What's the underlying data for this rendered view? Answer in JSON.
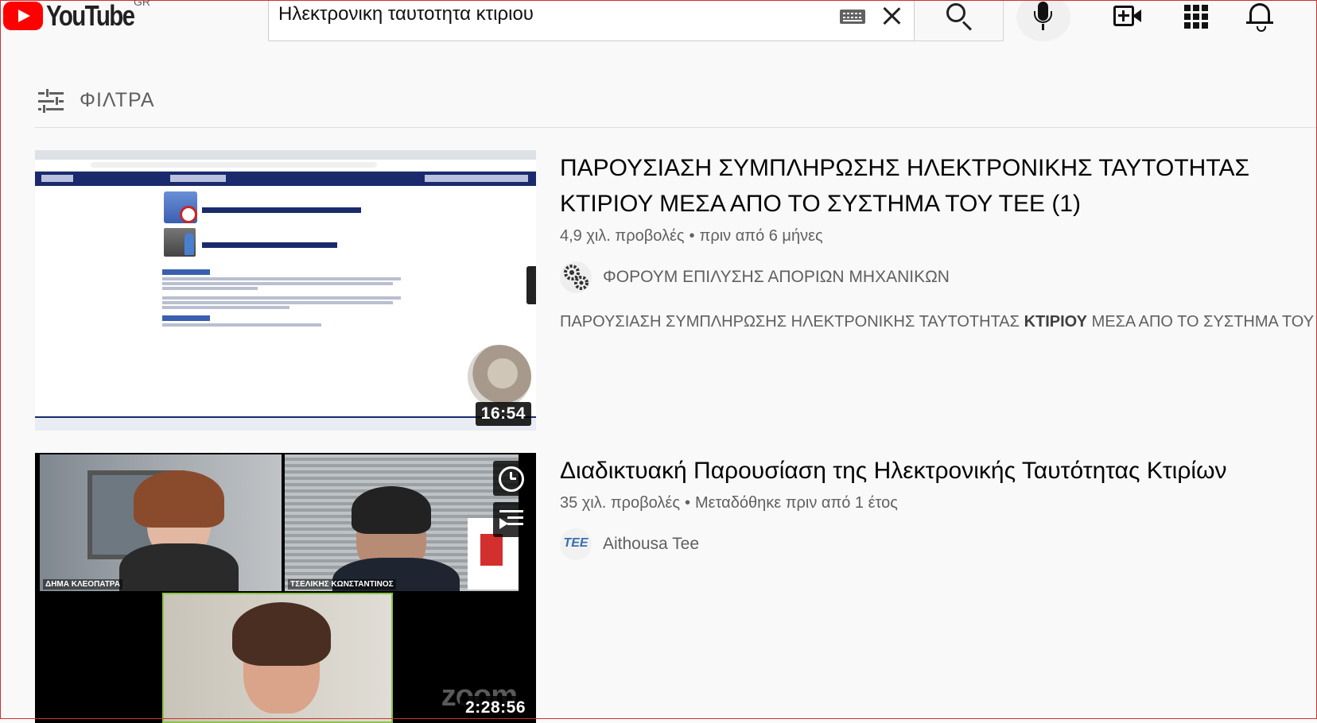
{
  "masthead": {
    "logo_text": "YouTube",
    "country_code": "GR",
    "search_value": "Ηλεκτρονικη ταυτοτητα κτιριου",
    "icons": [
      "keyboard-icon",
      "clear-icon",
      "search-icon",
      "mic-icon",
      "create-video-icon",
      "apps-icon",
      "notifications-icon"
    ]
  },
  "filters": {
    "label": "ΦΙΛΤΡΑ"
  },
  "results": [
    {
      "title": "ΠΑΡΟΥΣΙΑΣΗ ΣΥΜΠΛΗΡΩΣΗΣ ΗΛΕΚΤΡΟΝΙΚΗΣ ΤΑΥΤΟΤΗΤΑΣ ΚΤΙΡΙΟΥ ΜΕΣΑ ΑΠΟ ΤΟ ΣΥΣΤΗΜΑ ΤΟΥ ΤΕΕ (1)",
      "views": "4,9 χιλ. προβολές",
      "age": "πριν από 6 μήνες",
      "channel": "ΦΟΡΟΥΜ ΕΠΙΛΥΣΗΣ ΑΠΟΡΙΩΝ ΜΗΧΑΝΙΚΩΝ",
      "snippet_before": "ΠΑΡΟΥΣΙΑΣΗ ΣΥΜΠΛΗΡΩΣΗΣ ΗΛΕΚΤΡΟΝΙΚΗΣ ΤΑΥΤΟΤΗΤΑΣ ",
      "snippet_bold": "ΚΤΙΡΙΟΥ",
      "snippet_after": " ΜΕΣΑ ΑΠΟ ΤΟ ΣΥΣΤΗΜΑ ΤΟΥ",
      "duration": "16:54"
    },
    {
      "title": "Διαδικτυακή Παρουσίαση της Ηλεκτρονικής Ταυτότητας Κτιρίων",
      "views": "35 χιλ. προβολές",
      "age": "Μεταδόθηκε πριν από 1 έτος",
      "channel": "Aithousa Tee",
      "channel_avatar_text": "TEE",
      "duration": "2:28:56",
      "participants": [
        "ΔΗΜΑ ΚΛΕΟΠΑΤΡΑ",
        "ΤΣΕΛΙΚΗΣ ΚΩΝΣΤΑΝΤΙΝΟΣ"
      ],
      "watermark": "zoom"
    }
  ]
}
